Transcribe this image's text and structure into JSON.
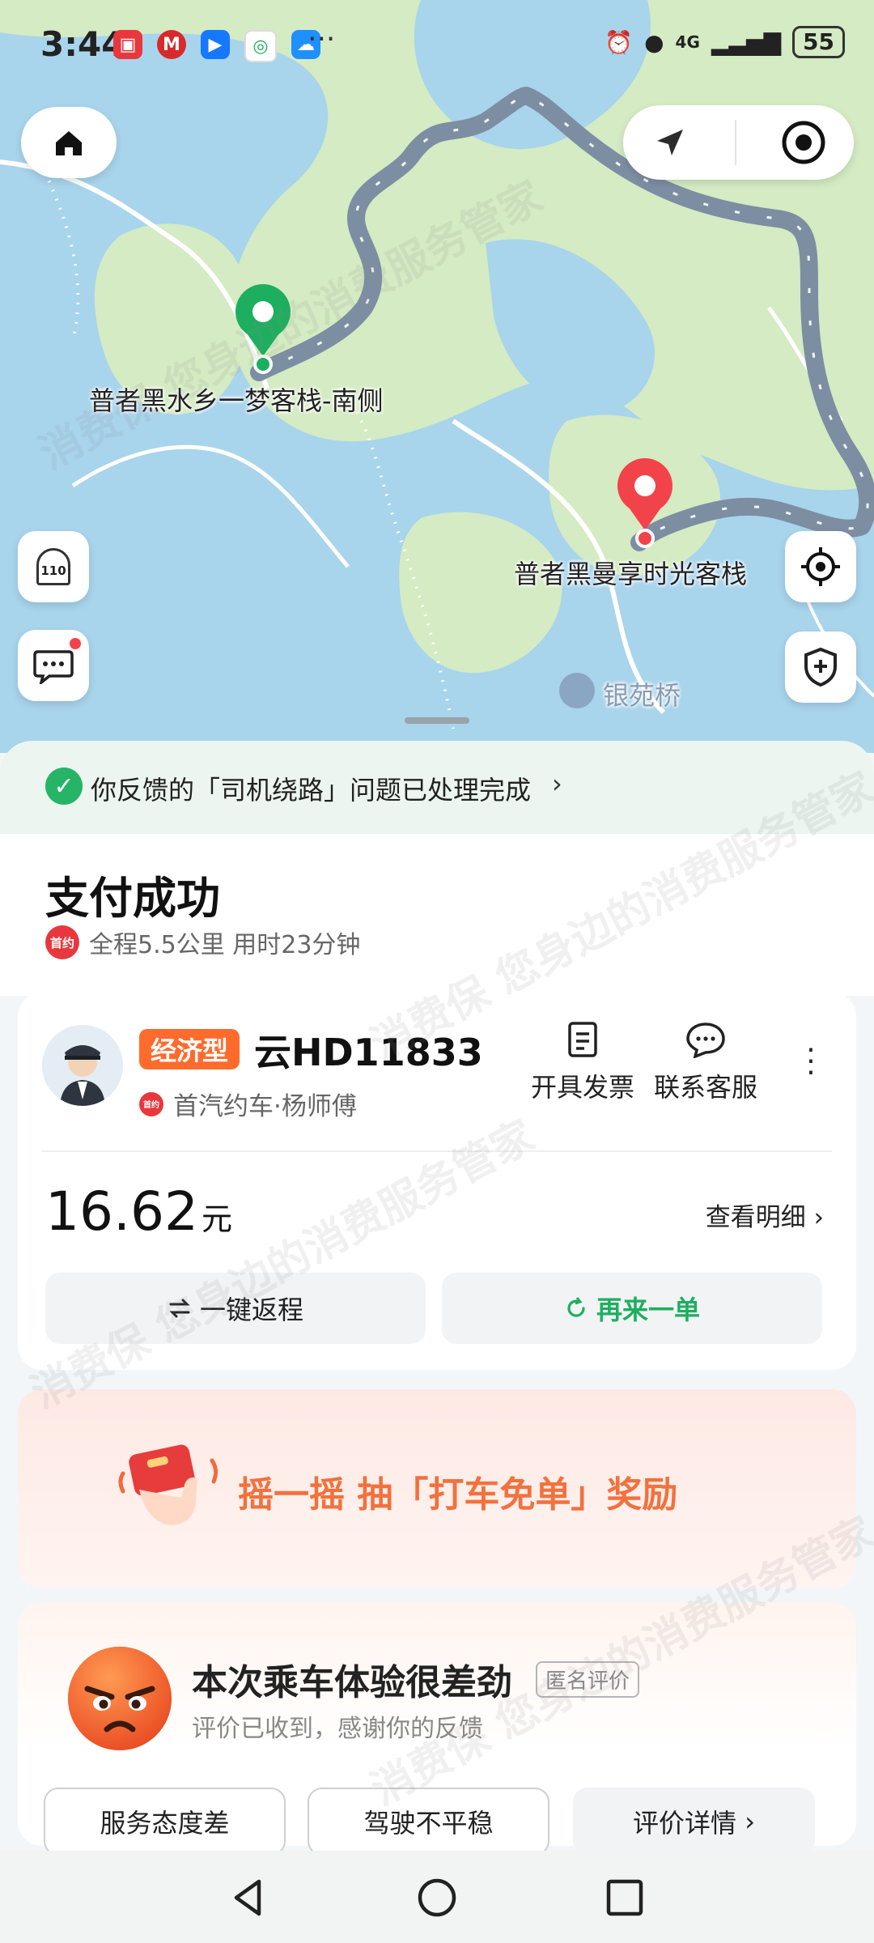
{
  "status_bar": {
    "time": "3:44",
    "network": "4G",
    "battery": "55"
  },
  "map": {
    "pickup_label": "普者黑水乡一梦客栈-南侧",
    "dropoff_label": "普者黑曼享时光客栈",
    "landmark_label": "银苑桥",
    "police_badge": "110"
  },
  "notice": {
    "text": "你反馈的「司机绕路」问题已处理完成",
    "chevron": "›"
  },
  "trip": {
    "title": "支付成功",
    "badge": "首约",
    "summary": "全程5.5公里 用时23分钟"
  },
  "order": {
    "car_type": "经济型",
    "plate": "云HD11833",
    "company_badge": "首约",
    "driver": "首汽约车·杨师傅",
    "actions": [
      {
        "label": "开具发票"
      },
      {
        "label": "联系客服"
      }
    ],
    "price": "16.62",
    "unit": "元",
    "detail_link": "查看明细",
    "return_trip": "一键返程",
    "reorder": "再来一单"
  },
  "promo": {
    "text": "摇一摇 抽「打车免单」奖励"
  },
  "rating": {
    "title": "本次乘车体验很差劲",
    "anon": "匿名评价",
    "subtitle": "评价已收到，感谢你的反馈",
    "chips": [
      "服务态度差",
      "驾驶不平稳"
    ],
    "detail": "评价详情"
  },
  "watermark": "消费保 您身边的消费服务管家",
  "colors": {
    "accent_green": "#1eae5f",
    "eco_orange": "#ff6b2c",
    "promo_orange": "#f2713d",
    "route": "#7d8ea3"
  }
}
